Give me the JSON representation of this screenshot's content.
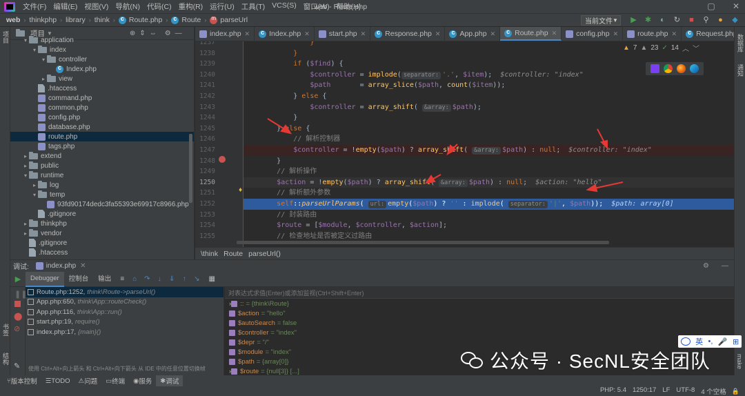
{
  "menubar": {
    "items": [
      "文件(F)",
      "编辑(E)",
      "视图(V)",
      "导航(N)",
      "代码(C)",
      "重构(R)",
      "运行(U)",
      "工具(T)",
      "VCS(S)",
      "窗口(W)",
      "帮助(H)"
    ],
    "window_title": "web - Route.php"
  },
  "navbar": {
    "crumbs": [
      "web",
      "thinkphp",
      "library",
      "think",
      "Route.php",
      "Route",
      "parseUrl"
    ],
    "run_config": "当前文件"
  },
  "project": {
    "title": "项目",
    "tree": [
      {
        "label": "application",
        "depth": 1,
        "kind": "folder",
        "open": true
      },
      {
        "label": "index",
        "depth": 2,
        "kind": "folder",
        "open": true
      },
      {
        "label": "controller",
        "depth": 3,
        "kind": "folder",
        "open": true
      },
      {
        "label": "Index.php",
        "depth": 4,
        "kind": "class"
      },
      {
        "label": "view",
        "depth": 3,
        "kind": "folder",
        "open": false
      },
      {
        "label": ".htaccess",
        "depth": 2,
        "kind": "file"
      },
      {
        "label": "command.php",
        "depth": 2,
        "kind": "php"
      },
      {
        "label": "common.php",
        "depth": 2,
        "kind": "php"
      },
      {
        "label": "config.php",
        "depth": 2,
        "kind": "php"
      },
      {
        "label": "database.php",
        "depth": 2,
        "kind": "php"
      },
      {
        "label": "route.php",
        "depth": 2,
        "kind": "php",
        "selected": true
      },
      {
        "label": "tags.php",
        "depth": 2,
        "kind": "php"
      },
      {
        "label": "extend",
        "depth": 1,
        "kind": "folder",
        "open": false
      },
      {
        "label": "public",
        "depth": 1,
        "kind": "folder",
        "open": false
      },
      {
        "label": "runtime",
        "depth": 1,
        "kind": "folder",
        "open": true
      },
      {
        "label": "log",
        "depth": 2,
        "kind": "folder",
        "open": false
      },
      {
        "label": "temp",
        "depth": 2,
        "kind": "folder",
        "open": true
      },
      {
        "label": "93fd90174dedc3fa55393e69917c8966.php",
        "depth": 3,
        "kind": "php"
      },
      {
        "label": ".gitignore",
        "depth": 2,
        "kind": "file"
      },
      {
        "label": "thinkphp",
        "depth": 1,
        "kind": "folder",
        "open": false
      },
      {
        "label": "vendor",
        "depth": 1,
        "kind": "folder",
        "open": false
      },
      {
        "label": ".gitignore",
        "depth": 1,
        "kind": "file"
      },
      {
        "label": ".htaccess",
        "depth": 1,
        "kind": "file"
      }
    ]
  },
  "tabs": [
    {
      "label": "index.php",
      "icon": "php"
    },
    {
      "label": "Index.php",
      "icon": "class"
    },
    {
      "label": "start.php",
      "icon": "php"
    },
    {
      "label": "Response.php",
      "icon": "class"
    },
    {
      "label": "App.php",
      "icon": "class"
    },
    {
      "label": "Route.php",
      "icon": "class",
      "active": true
    },
    {
      "label": "config.php",
      "icon": "php"
    },
    {
      "label": "route.php",
      "icon": "php"
    },
    {
      "label": "Request.php",
      "icon": "class"
    }
  ],
  "inspections": {
    "warnings": "7",
    "weak": "23",
    "ok": "14"
  },
  "editor": {
    "lines": [
      {
        "n": "1237",
        "html": "                <span class=\"kw\">}</span>"
      },
      {
        "n": "1238",
        "html": "            <span class=\"kw\">}</span>"
      },
      {
        "n": "1239",
        "html": "            <span class=\"kw\">if</span> (<span class=\"var\">$find</span>) {"
      },
      {
        "n": "1240",
        "html": "                <span class=\"var\">$controller</span> = <span class=\"fn\">implode</span>(<span class=\"hint\">separator:</span><span class=\"str\">'.'</span>, <span class=\"var\">$item</span>);  <span class=\"dbg\">$controller: \"index\"</span>"
      },
      {
        "n": "1241",
        "html": "                <span class=\"var\">$path</span>       = <span class=\"fn\">array_slice</span>(<span class=\"var\">$path</span>, <span class=\"fn\">count</span>(<span class=\"var\">$item</span>));"
      },
      {
        "n": "1242",
        "html": "            } <span class=\"kw\">else</span> {"
      },
      {
        "n": "1243",
        "html": "                <span class=\"var\">$controller</span> = <span class=\"fn\">array_shift</span>( <span class=\"hint\">&amp;array:</span><span class=\"var\">$path</span>);"
      },
      {
        "n": "1244",
        "html": "            }"
      },
      {
        "n": "1245",
        "html": "        } <span class=\"kw\">else</span> {"
      },
      {
        "n": "1246",
        "html": "            <span class=\"cm\">// 解析控制器</span>"
      },
      {
        "n": "1247",
        "html": "            <span class=\"var\">$controller</span> = !<span class=\"fn\">empty</span>(<span class=\"var\">$path</span>) ? <span class=\"fn\">array_shift</span>( <span class=\"hint\">&amp;array:</span><span class=\"var\">$path</span>) : <span class=\"kw\">null</span>;  <span class=\"dbg\">$controller: \"index\"</span>",
        "bp": true
      },
      {
        "n": "1248",
        "html": "        }"
      },
      {
        "n": "1249",
        "html": "        <span class=\"cm\">// 解析操作</span>"
      },
      {
        "n": "1250",
        "html": "        <span class=\"var\">$action</span> = !<span class=\"fn\">empty</span>(<span class=\"var\">$path</span>) ? <span class=\"fn\">array_shift</span>( <span class=\"hint\">&amp;array:</span><span class=\"var\">$path</span>) : <span class=\"kw\">null</span>;  <span class=\"dbg\">$action: \"hello\"</span>",
        "caret": true
      },
      {
        "n": "1251",
        "html": "        <span class=\"cm\">// 解析额外参数</span>"
      },
      {
        "n": "1252",
        "html": "        <span class=\"kw\">self</span>::<span class=\"fn it\">parseUrlParams</span>( <span class=\"hint\">url:</span><span class=\"fn\">empty</span>(<span class=\"var\">$path</span>) ? <span class=\"str\">''</span> : <span class=\"fn\">implode</span>( <span class=\"hint\">separator:</span><span class=\"str\">'|'</span>, <span class=\"var\">$path</span>));  <span class=\"dbg\">$path: array[0]</span>",
        "exec": true
      },
      {
        "n": "1253",
        "html": "        <span class=\"cm\">// 封装路由</span>"
      },
      {
        "n": "1254",
        "html": "        <span class=\"var\">$route</span> = [<span class=\"var\">$module</span>, <span class=\"var\">$controller</span>, <span class=\"var\">$action</span>];"
      },
      {
        "n": "1255",
        "html": "        <span class=\"cm\">// 检查地址是否被定义过路由</span>"
      }
    ]
  },
  "editor_crumbs": [
    "\\think",
    "Route",
    "parseUrl()"
  ],
  "debug": {
    "label": "调试:",
    "session": "index.php",
    "tabs": [
      "Debugger",
      "控制台",
      "输出"
    ],
    "frames": [
      {
        "file": "Route.php:1252,",
        "cls": "think\\Route->parseUrl()"
      },
      {
        "file": "App.php:650,",
        "cls": "think\\App::routeCheck()"
      },
      {
        "file": "App.php:116,",
        "cls": "think\\App::run()"
      },
      {
        "file": "start.php:19,",
        "cls": "require()"
      },
      {
        "file": "index.php:17,",
        "cls": "{main}()"
      }
    ],
    "frames_hint": "使用 Ctrl+Alt+向上箭头 和 Ctrl+Alt+向下箭头 从 IDE 中的任意位置切换帧",
    "eval_placeholder": "对表达式求值(Enter)或添加监视(Ctrl+Shift+Enter)",
    "vars": [
      {
        "name": "::",
        "value": "= {think\\Route}",
        "expand": true
      },
      {
        "name": "$action",
        "value": "= \"hello\""
      },
      {
        "name": "$autoSearch",
        "value": "= false"
      },
      {
        "name": "$controller",
        "value": "= \"index\""
      },
      {
        "name": "$depr",
        "value": "= \"/\""
      },
      {
        "name": "$module",
        "value": "= \"index\""
      },
      {
        "name": "$path",
        "value": "= {array[0]}"
      },
      {
        "name": "$route",
        "value": "= {null[3]} [...]",
        "expand": true
      }
    ]
  },
  "statusbar": {
    "tools": [
      "版本控制",
      "TODO",
      "问题",
      "终端",
      "服务",
      "调试"
    ],
    "right": [
      "PHP: 5.4",
      "1250:17",
      "LF",
      "UTF-8",
      "4 个空格"
    ]
  },
  "side_labels": {
    "left_top": "项目",
    "left_bottom1": "书签",
    "left_bottom2": "结构",
    "right_top": "数据库",
    "right_mid": "通知",
    "right_bot": "make"
  },
  "watermark": "公众号 · SecNL安全团队",
  "ime": {
    "lang": "英"
  }
}
